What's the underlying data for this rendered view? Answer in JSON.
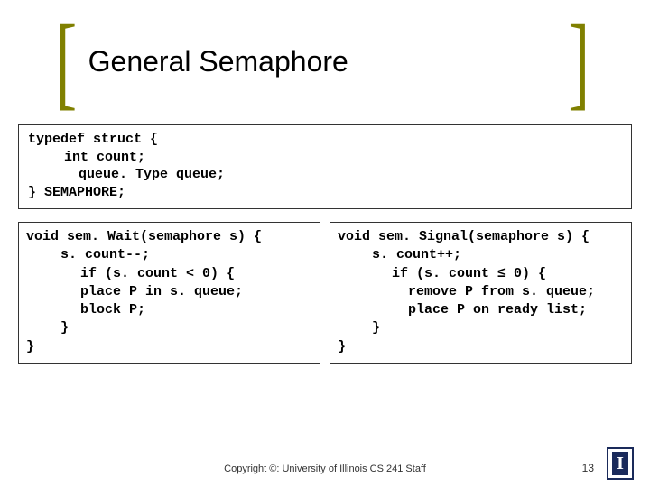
{
  "title": "General Semaphore",
  "typedef": {
    "l1": "typedef struct {",
    "l2": "int count;",
    "l3": "queue. Type queue;",
    "l4": "} SEMAPHORE;"
  },
  "wait": {
    "l1": "void sem. Wait(semaphore s) {",
    "l2": "s. count--;",
    "l3": "if (s. count < 0) {",
    "l4": "place P in s. queue;",
    "l5": "block P;",
    "l6": "}",
    "l7": "}"
  },
  "signal": {
    "l1": "void sem. Signal(semaphore s) {",
    "l2": "s. count++;",
    "l3": "if (s. count ≤ 0) {",
    "l4": "remove P from s. queue;",
    "l5": "place P on ready list;",
    "l6": "}",
    "l7": "}"
  },
  "footer": {
    "copyright": "Copyright ©: University of Illinois CS 241 Staff",
    "page": "13",
    "logo_letter": "I"
  }
}
